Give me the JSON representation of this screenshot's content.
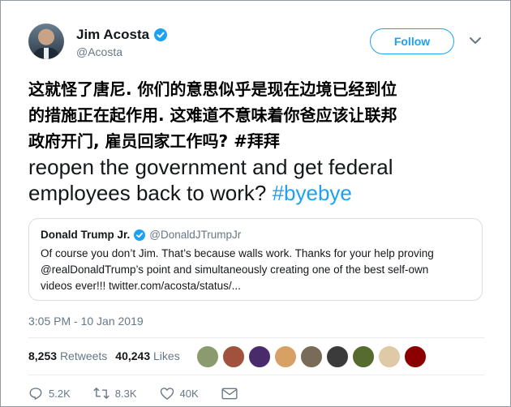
{
  "author": {
    "display_name": "Jim Acosta",
    "handle": "@Acosta",
    "verified": true
  },
  "follow_button": {
    "label": "Follow"
  },
  "tweet": {
    "overlay_zh_line1": "这就怪了唐尼. 你们的意思似乎是现在边境已经到位",
    "overlay_zh_line2": "的措施正在起作用. 这难道不意味着你爸应该让联邦",
    "overlay_zh_line3": "政府开门, 雇员回家工作吗? #拜拜",
    "text_line4": "reopen the government and get federal",
    "text_line5_pre": "employees back to work? ",
    "hashtag": "#byebye"
  },
  "quoted_tweet": {
    "display_name": "Donald Trump Jr.",
    "handle": "@DonaldJTrumpJr",
    "verified": true,
    "line1": "Of course you don’t Jim. That’s because walls work. Thanks for your help proving",
    "line2": "@realDonaldTrump’s point and simultaneously creating one of the best self-own",
    "line3": "videos ever!!! twitter.com/acosta/status/..."
  },
  "timestamp": "3:05 PM - 10 Jan 2019",
  "stats": {
    "retweets_count": "8,253",
    "retweets_label": "Retweets",
    "likes_count": "40,243",
    "likes_label": "Likes"
  },
  "likers": [
    {
      "color": "#8a9b6e"
    },
    {
      "color": "#a0523d"
    },
    {
      "color": "#4b2a6b"
    },
    {
      "color": "#d9a066"
    },
    {
      "color": "#7a6a58"
    },
    {
      "color": "#3b3b3b"
    },
    {
      "color": "#556b2f"
    },
    {
      "color": "#e0c9a6"
    },
    {
      "color": "#8b0000"
    }
  ],
  "actions": {
    "reply": {
      "icon": "reply-icon",
      "count": "5.2K"
    },
    "retweet": {
      "icon": "retweet-icon",
      "count": "8.3K"
    },
    "like": {
      "icon": "heart-icon",
      "count": "40K"
    },
    "message": {
      "icon": "mail-icon"
    }
  },
  "colors": {
    "accent": "#1da1f2",
    "secondary_text": "#657786",
    "primary_text": "#14171a"
  }
}
